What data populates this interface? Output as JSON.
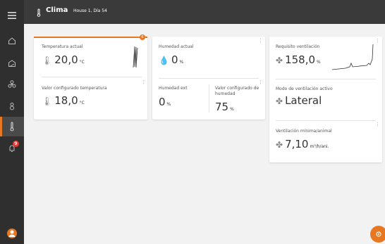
{
  "header": {
    "title": "Clima",
    "subtitle": "House 1, Día 54"
  },
  "sidebar": {
    "alarm_count": "9"
  },
  "cards": {
    "temp_actual": {
      "label": "Temperatura actual",
      "value": "20,0",
      "unit": "°C",
      "badge": "6"
    },
    "temp_set": {
      "label": "Valor configurado temperatura",
      "value": "18,0",
      "unit": "°C"
    },
    "hum_actual": {
      "label": "Humedad actual",
      "value": "0",
      "unit": "%"
    },
    "hum_ext": {
      "label": "Humedad ext",
      "value": "0",
      "unit": "%"
    },
    "hum_set": {
      "label": "Valor configurado de humedad",
      "value": "75",
      "unit": "%"
    },
    "vent_req": {
      "label": "Requisito ventilación",
      "value": "158,0",
      "unit": "%"
    },
    "vent_mode": {
      "label": "Modo de ventilación activo",
      "value": "Lateral"
    },
    "vent_min": {
      "label": "Ventilación mínima/animal",
      "value": "7,10",
      "unit": "m³/h/ani."
    }
  },
  "colors": {
    "accent": "#e87722",
    "sidebar": "#2f2f2f",
    "topbar": "#3a3a3a",
    "alarm": "#e53935"
  }
}
